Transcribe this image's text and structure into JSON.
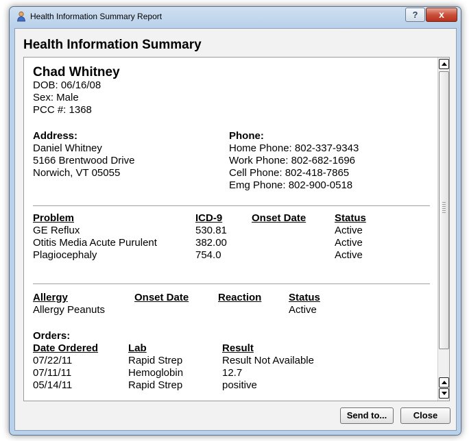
{
  "window": {
    "title": "Health Information Summary Report"
  },
  "titlebar": {
    "help_label": "?",
    "close_label": "x"
  },
  "report": {
    "heading": "Health Information Summary",
    "patient": {
      "name": "Chad Whitney",
      "dob": "DOB: 06/16/08",
      "sex": "Sex: Male",
      "pcc": "PCC #: 1368"
    },
    "address": {
      "label": "Address:",
      "lines": [
        "Daniel Whitney",
        "5166 Brentwood Drive",
        "Norwich, VT 05055"
      ]
    },
    "phone": {
      "label": "Phone:",
      "lines": [
        "Home Phone: 802-337-9343",
        "Work Phone: 802-682-1696",
        "Cell Phone: 802-418-7865",
        "Emg Phone: 802-900-0518"
      ]
    },
    "problems": {
      "headers": {
        "problem": "Problem",
        "icd9": "ICD-9",
        "onset": "Onset Date",
        "status": "Status"
      },
      "rows": [
        {
          "problem": "GE Reflux",
          "icd9": "530.81",
          "onset": "",
          "status": "Active"
        },
        {
          "problem": "Otitis Media Acute Purulent",
          "icd9": "382.00",
          "onset": "",
          "status": "Active"
        },
        {
          "problem": "Plagiocephaly",
          "icd9": "754.0",
          "onset": "",
          "status": "Active"
        }
      ]
    },
    "allergies": {
      "headers": {
        "allergy": "Allergy",
        "onset": "Onset Date",
        "reaction": "Reaction",
        "status": "Status"
      },
      "rows": [
        {
          "allergy": "Allergy Peanuts",
          "onset": "",
          "reaction": "",
          "status": "Active"
        }
      ]
    },
    "orders": {
      "label": "Orders:",
      "headers": {
        "date": "Date Ordered",
        "lab": "Lab",
        "result": "Result"
      },
      "rows": [
        {
          "date": "07/22/11",
          "lab": "Rapid Strep",
          "result": "Result Not Available"
        },
        {
          "date": "07/11/11",
          "lab": "Hemoglobin",
          "result": "12.7"
        },
        {
          "date": "05/14/11",
          "lab": "Rapid Strep",
          "result": "positive"
        }
      ]
    }
  },
  "footer": {
    "send_label": "Send to...",
    "close_label": "Close"
  }
}
